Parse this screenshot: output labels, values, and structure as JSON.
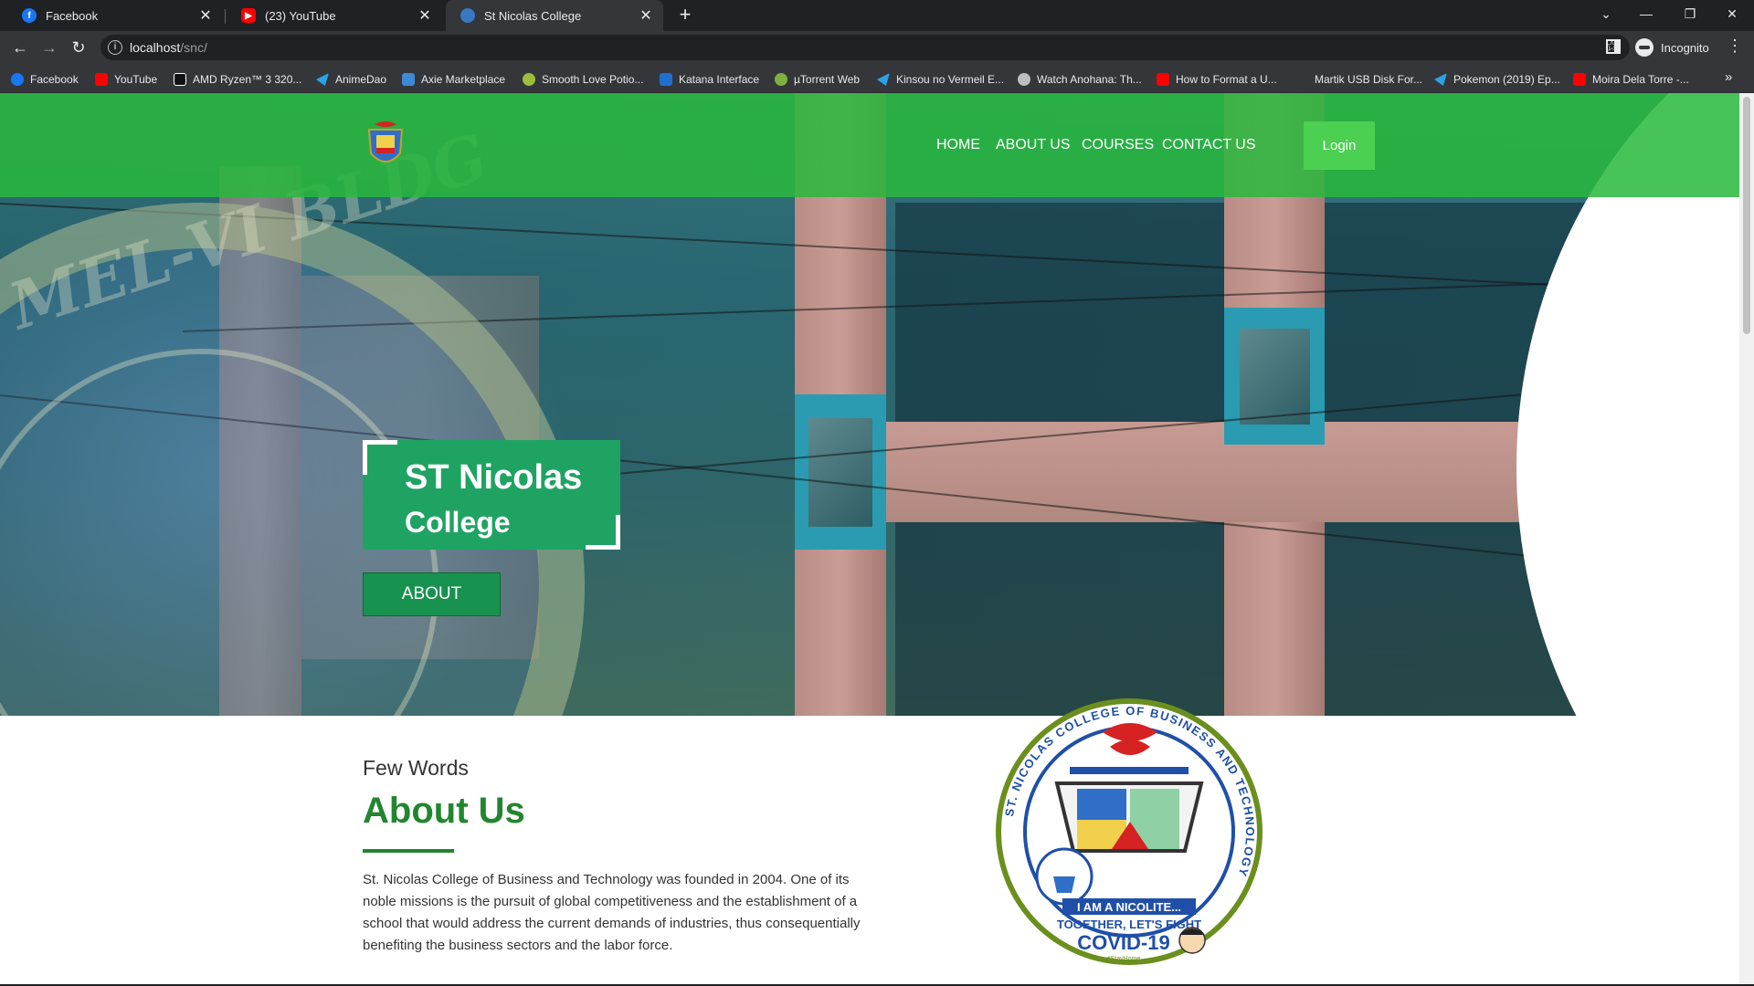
{
  "browser": {
    "tabs": [
      {
        "title": "Facebook",
        "icon": "facebook-icon",
        "color": "#1877f2",
        "active": false
      },
      {
        "title": "(23) YouTube",
        "icon": "youtube-icon",
        "color": "#ff0000",
        "active": false
      },
      {
        "title": "St Nicolas College",
        "icon": "college-seal-icon",
        "color": "#3a78c4",
        "active": true
      }
    ],
    "new_tab_glyph": "+",
    "url_host": "localhost",
    "url_path": "/snc/",
    "profile_label": "Incognito",
    "bookmarks": [
      {
        "label": "Facebook",
        "icon": "facebook-icon",
        "color": "#1877f2"
      },
      {
        "label": "YouTube",
        "icon": "youtube-icon",
        "color": "#ff0000"
      },
      {
        "label": "AMD Ryzen™ 3 320...",
        "icon": "amd-icon",
        "color": "#ffffff"
      },
      {
        "label": "AnimeDao",
        "icon": "telegram-icon",
        "color": "#2aa3e6"
      },
      {
        "label": "Axie Marketplace",
        "icon": "axie-icon",
        "color": "#3d8ad8"
      },
      {
        "label": "Smooth Love Potio...",
        "icon": "slp-icon",
        "color": "#9ebd3a"
      },
      {
        "label": "Katana Interface",
        "icon": "katana-icon",
        "color": "#1f6fd1"
      },
      {
        "label": "µTorrent Web",
        "icon": "utorrent-icon",
        "color": "#7db13f"
      },
      {
        "label": "Kinsou no Vermeil E...",
        "icon": "telegram-icon",
        "color": "#2aa3e6"
      },
      {
        "label": "Watch Anohana: Th...",
        "icon": "globe-icon",
        "color": "#bdbdbd"
      },
      {
        "label": "How to Format a U...",
        "icon": "youtube-icon",
        "color": "#ff0000"
      },
      {
        "label": "Martik USB Disk For...",
        "icon": "blank-page-icon",
        "color": "#35363a"
      },
      {
        "label": "Pokemon (2019) Ep...",
        "icon": "telegram-icon",
        "color": "#2aa3e6"
      },
      {
        "label": "Moira Dela Torre -...",
        "icon": "youtube-icon",
        "color": "#ff0000"
      }
    ]
  },
  "site": {
    "nav": [
      "HOME",
      "ABOUT US",
      "COURSES",
      "CONTACT US"
    ],
    "login_label": "Login",
    "hero_title_line1": "ST Nicolas",
    "hero_title_line2": "College",
    "about_button": "ABOUT",
    "few_words": "Few Words",
    "about_heading": "About Us",
    "about_paragraph": "St. Nicolas College of Business and Technology was founded in 2004. One of its noble missions is the pursuit of global competitiveness and the establishment of a school that would address the current demands of industries, thus consequentially benefiting the business sectors and the labor force.",
    "seal": {
      "ring_text": "ST. NICOLAS COLLEGE OF BUSINESS AND TECHNOLOGY",
      "banner_line1": "I AM A NICOLITE...",
      "banner_line2": "TOGETHER, LET'S FIGHT",
      "banner_line3": "COVID-19",
      "hashtag": "#StayHome"
    },
    "colors": {
      "brand_green": "#22862f",
      "topbar_green": "#28b93c",
      "card_green": "#1fa363",
      "login_green": "#4bd051"
    }
  }
}
